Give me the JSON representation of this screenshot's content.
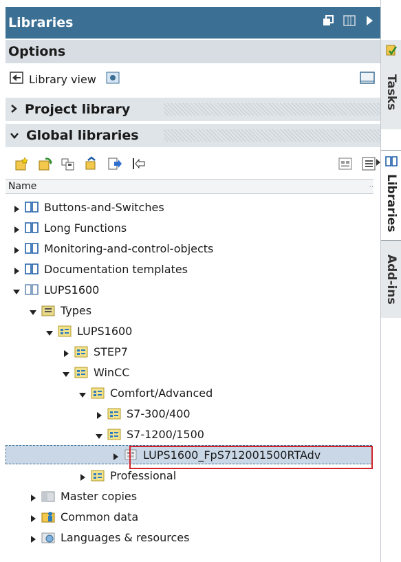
{
  "panel": {
    "title": "Libraries",
    "options_label": "Options",
    "library_view_label": "Library view",
    "project_library_label": "Project library",
    "global_libraries_label": "Global libraries",
    "name_column": "Name"
  },
  "tree": [
    {
      "label": "Buttons-and-Switches",
      "level": 0,
      "expanded": false,
      "icon": "library-book-icon"
    },
    {
      "label": "Long Functions",
      "level": 0,
      "expanded": false,
      "icon": "library-book-icon"
    },
    {
      "label": "Monitoring-and-control-objects",
      "level": 0,
      "expanded": false,
      "icon": "library-book-icon"
    },
    {
      "label": "Documentation templates",
      "level": 0,
      "expanded": false,
      "icon": "library-book-icon"
    },
    {
      "label": "LUPS1600",
      "level": 0,
      "expanded": true,
      "icon": "library-book-gray-icon"
    },
    {
      "label": "Types",
      "level": 1,
      "expanded": true,
      "icon": "types-folder-icon"
    },
    {
      "label": "LUPS1600",
      "level": 2,
      "expanded": true,
      "icon": "type-group-folder-icon"
    },
    {
      "label": "STEP7",
      "level": 3,
      "expanded": false,
      "icon": "type-group-folder-icon"
    },
    {
      "label": "WinCC",
      "level": 3,
      "expanded": true,
      "icon": "type-group-folder-icon"
    },
    {
      "label": "Comfort/Advanced",
      "level": 4,
      "expanded": true,
      "icon": "type-group-folder-icon"
    },
    {
      "label": "S7-300/400",
      "level": 5,
      "expanded": false,
      "icon": "type-group-folder-icon"
    },
    {
      "label": "S7-1200/1500",
      "level": 5,
      "expanded": true,
      "icon": "type-group-folder-icon"
    },
    {
      "label": "LUPS1600_FpS712001500RTAdv",
      "level": 6,
      "expanded": false,
      "icon": "faceplate-type-icon",
      "selected": true
    },
    {
      "label": "Professional",
      "level": 4,
      "expanded": false,
      "icon": "type-group-folder-icon"
    },
    {
      "label": "Master copies",
      "level": 1,
      "expanded": false,
      "icon": "master-copies-folder-icon"
    },
    {
      "label": "Common data",
      "level": 1,
      "expanded": false,
      "icon": "common-data-icon"
    },
    {
      "label": "Languages & resources",
      "level": 1,
      "expanded": false,
      "icon": "languages-icon"
    }
  ],
  "side_tabs": {
    "tasks": "Tasks",
    "libraries": "Libraries",
    "addins": "Add-ins"
  },
  "colors": {
    "title_bar": "#3b6f93",
    "selection": "#c9d7e6",
    "highlight_border": "#d2232a"
  }
}
